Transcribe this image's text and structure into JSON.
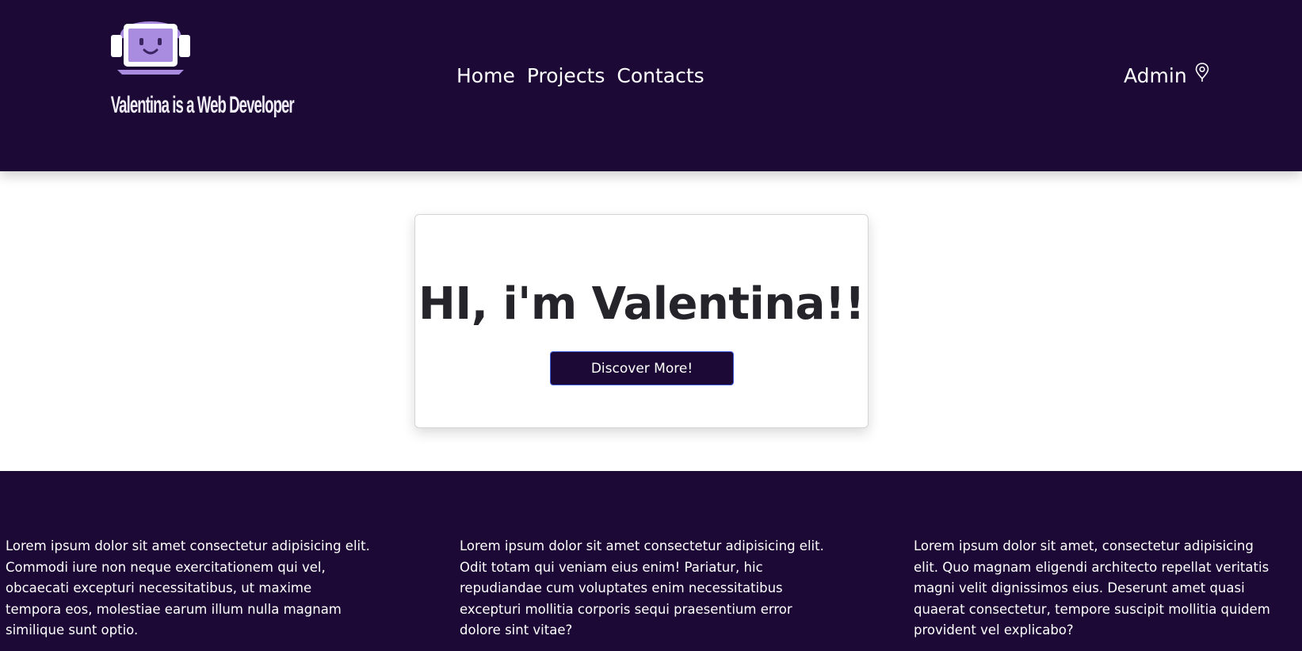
{
  "header": {
    "logo": {
      "text": "Valentina is a Web Developer",
      "icon": "laptop-headphones-smiley-icon",
      "colors": {
        "primary": "#a98be0",
        "light": "#ffffff"
      }
    },
    "nav": [
      {
        "label": "Home"
      },
      {
        "label": "Projects"
      },
      {
        "label": "Contacts"
      }
    ],
    "admin": {
      "label": "Admin",
      "icon": "map-pin-icon"
    }
  },
  "hero": {
    "title": "HI, i'm Valentina!!",
    "button_label": "Discover More!"
  },
  "footer": {
    "columns": [
      {
        "text": "Lorem ipsum dolor sit amet consectetur adipisicing elit. Commodi iure non neque exercitationem qui vel, obcaecati excepturi necessitatibus, ut maxime tempora eos, molestiae earum illum nulla magnam similique sunt optio."
      },
      {
        "text": "Lorem ipsum dolor sit amet consectetur adipisicing elit. Odit totam qui veniam eius enim! Pariatur, hic repudiandae cum voluptates enim necessitatibus excepturi mollitia corporis sequi praesentium error dolore sint vitae?"
      },
      {
        "text": "Lorem ipsum dolor sit amet, consectetur adipisicing elit. Quo magnam eligendi architecto repellat veritatis magni velit dignissimos eius. Deserunt amet quasi quaerat consectetur, tempore suscipit mollitia quidem provident vel explicabo?"
      }
    ]
  },
  "colors": {
    "brand_dark": "#1c0936",
    "button_border": "#3b5bdb",
    "title_text": "#25242a"
  }
}
